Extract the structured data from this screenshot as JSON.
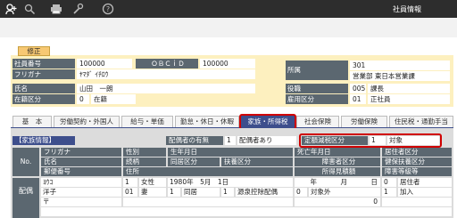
{
  "window": {
    "title": "社員情報"
  },
  "toolbar": {
    "icons": [
      "add-user-icon",
      "search-icon",
      "print-icon",
      "tools-icon",
      "help-icon"
    ]
  },
  "edit_badge": "修正",
  "header": {
    "employee_no_label": "社員番号",
    "employee_no": "100000",
    "obcid_label": "ＯＢＣｉＤ",
    "obcid": "100000",
    "furigana_label": "フリガナ",
    "furigana": "ﾔﾏﾀﾞ ｲﾁﾛｳ",
    "name_label": "氏名",
    "name": "山田　一朗",
    "status_label": "在籍区分",
    "status_code": "0",
    "status": "在籍",
    "dept_label": "所属",
    "dept_code": "301",
    "dept_name": "営業部 東日本営業課",
    "post_label": "役職",
    "post_code": "005",
    "post_name": "課長",
    "emp_type_label": "雇用区分",
    "emp_type_code": "01",
    "emp_type_name": "正社員"
  },
  "tabs": [
    "基　本",
    "労働契約・外国人",
    "給与・単価",
    "勤怠・休日・休暇",
    "家族・所得税",
    "社会保険",
    "労働保険",
    "住民税・通勤手当"
  ],
  "active_tab": "家族・所得税",
  "family": {
    "section_title": "【家族情報】",
    "spouse_label": "配偶者の有無",
    "spouse_code": "1",
    "spouse_value": "配偶者あり",
    "deduction_label": "定額減税区分",
    "deduction_code": "1",
    "deduction_value": "対象",
    "headers": {
      "no": "No.",
      "r1": [
        "フリガナ",
        "性別",
        "生年月日",
        "死亡年月日",
        "居住者区分"
      ],
      "r2": [
        "氏名",
        "続柄",
        "同居区分",
        "扶養区分",
        "障害者区分",
        "健保扶養区分"
      ],
      "r3": [
        "郵便番号",
        "住所",
        "所得見積額",
        "障害等級等"
      ]
    },
    "row_label": "配偶",
    "row": {
      "furigana": "ﾖｳｺ",
      "sex_code": "1",
      "sex": "女性",
      "birth": "1980年　5月　1日",
      "death_y": "年",
      "death_m": "月",
      "death_d": "日",
      "resident_code": "0",
      "resident": "居住者",
      "name": "洋子",
      "rel_code": "01",
      "rel": "妻",
      "cohabit_code": "1",
      "cohabit": "同居",
      "dep_code": "1",
      "dep": "源泉控除配偶",
      "dis_code": "0",
      "dis": "対象外",
      "hi_code": "1",
      "hi": "加入",
      "zip": "〒",
      "amount": "0"
    }
  }
}
